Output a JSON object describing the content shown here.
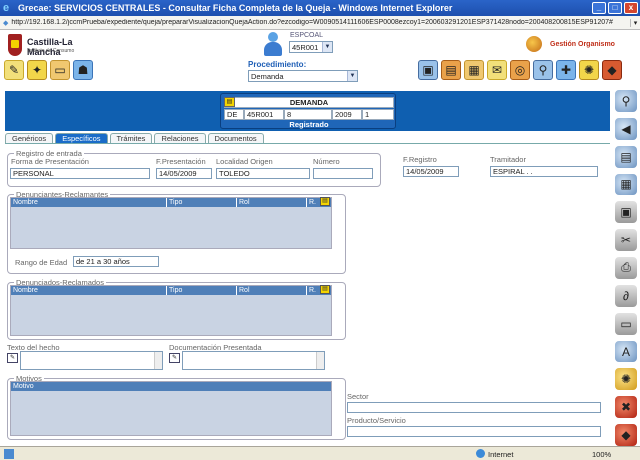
{
  "window": {
    "title": "Grecae: SERVICIOS CENTRALES - Consultar Ficha Completa de la Queja - Windows Internet Explorer"
  },
  "address": {
    "url": "http://192.168.1.2/jccmPrueba/expediente/queja/prepararVisualizacionQuejaAction.do?ezcodigo=W0090514111606ESP0008ezcoy1=200603291201ESP371428nodo=200408200815ESP91207#"
  },
  "header": {
    "logo_text": "Castilla-La Mancha",
    "logo_sub": "Instituto de Consumo",
    "espcoal_label": "ESPCOAL",
    "espcoal_value": "45R001",
    "gestion_label": "Gestión Organismo",
    "procedimiento_label": "Procedimiento:",
    "procedimiento_value": "Demanda"
  },
  "demanda": {
    "title": "DEMANDA",
    "code_type": "DE",
    "office": "45R001",
    "number": "8",
    "year": "2009",
    "seq": "1",
    "status": "Registrado"
  },
  "tabs": [
    "Genéricos",
    "Específicos",
    "Trámites",
    "Relaciones",
    "Documentos"
  ],
  "registro": {
    "legend": "Registro de entrada",
    "forma_label": "Forma de Presentación",
    "forma_value": "PERSONAL",
    "fpres_label": "F.Presentación",
    "fpres_value": "14/05/2009",
    "localidad_label": "Localidad Origen",
    "localidad_value": "TOLEDO",
    "numero_label": "Número",
    "numero_value": "",
    "fregistro_label": "F.Registro",
    "fregistro_value": "14/05/2009",
    "tramitador_label": "Tramitador",
    "tramitador_value": "ESPIRAL . ."
  },
  "denunciantes": {
    "legend": "Denunciantes-Reclamantes",
    "columns": [
      "Nombre",
      "Tipo",
      "Rol",
      "R."
    ],
    "rango_label": "Rango de Edad",
    "rango_value": "de 21 a 30 años"
  },
  "denunciados": {
    "legend": "Denunciados-Reclamados",
    "columns": [
      "Nombre",
      "Tipo",
      "Rol",
      "R."
    ]
  },
  "texto_label": "Texto del hecho",
  "documentacion_label": "Documentación Presentada",
  "motivos": {
    "legend": "Motivos",
    "column": "Motivo"
  },
  "sector_label": "Sector",
  "producto_label": "Producto/Servicio",
  "status": {
    "text": "",
    "zone": "Internet",
    "zoom": "100%"
  },
  "colors": {
    "accent": "#0f5fb0",
    "active_tab": "#1a6cc8",
    "grid_header": "#4f7fb8"
  }
}
